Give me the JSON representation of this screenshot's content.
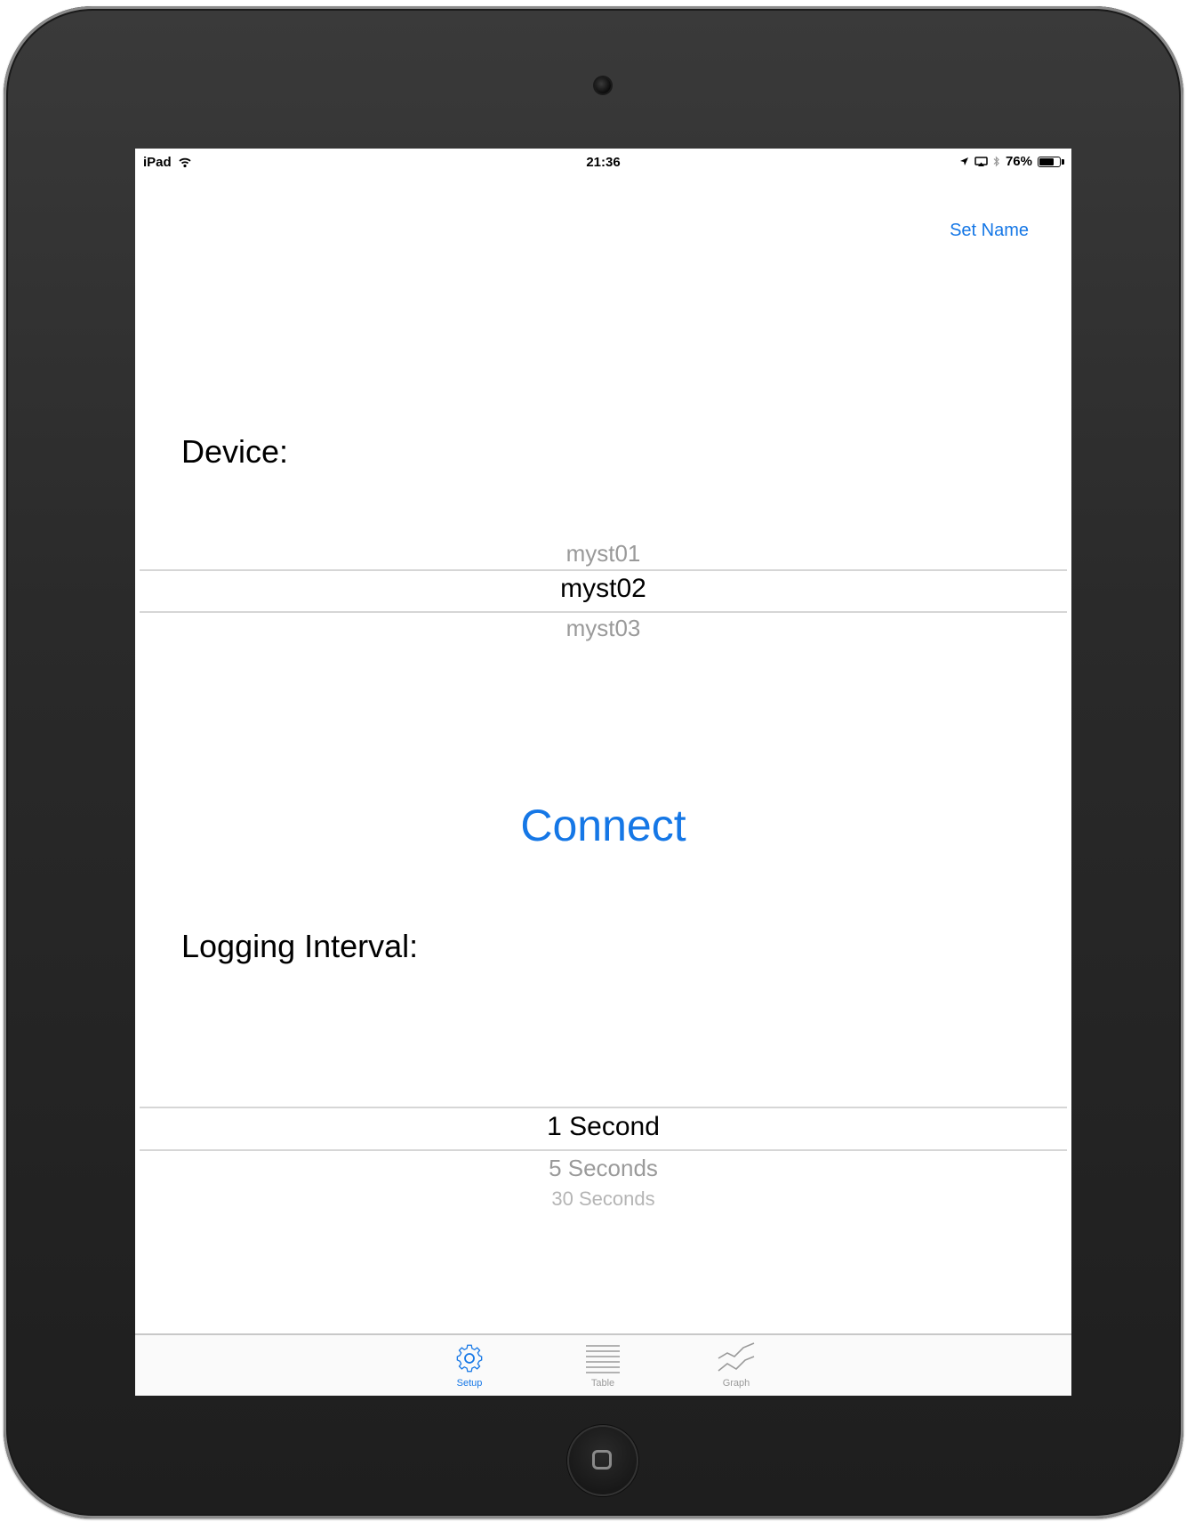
{
  "status_bar": {
    "device": "iPad",
    "time": "21:36",
    "battery": "76%",
    "battery_level": 0.76,
    "icons": [
      "wifi-icon",
      "location-arrow-icon",
      "airplay-icon",
      "bluetooth-icon",
      "battery-icon"
    ]
  },
  "header": {
    "set_name_label": "Set Name"
  },
  "device_section": {
    "label": "Device:",
    "options": [
      "myst01",
      "myst02",
      "myst03"
    ],
    "selected": "myst02"
  },
  "connect_label": "Connect",
  "logging_section": {
    "label": "Logging Interval:",
    "options": [
      "1 Second",
      "5 Seconds",
      "30 Seconds"
    ],
    "selected": "1 Second"
  },
  "tab_bar": {
    "tabs": [
      {
        "label": "Setup",
        "icon": "gear-icon",
        "active": true
      },
      {
        "label": "Table",
        "icon": "list-icon",
        "active": false
      },
      {
        "label": "Graph",
        "icon": "graph-icon",
        "active": false
      }
    ]
  },
  "colors": {
    "accent": "#1577e6",
    "bezel": "#2a2a2a",
    "picker_unselected": "#9a9a9a",
    "divider": "#d6d6d6"
  }
}
